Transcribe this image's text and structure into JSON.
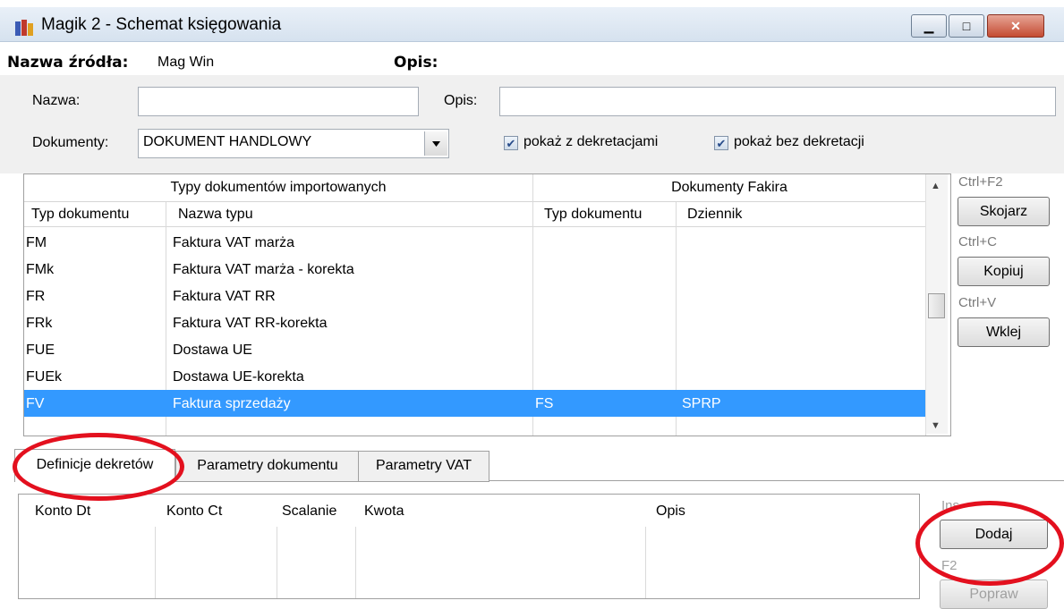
{
  "window": {
    "title": "Magik 2 - Schemat księgowania",
    "controls": {
      "minimize": "▁",
      "maximize": "□",
      "close": "✕"
    }
  },
  "source": {
    "label": "Nazwa źródła:",
    "value": "Mag Win",
    "opis_label": "Opis:"
  },
  "form": {
    "nazwa_label": "Nazwa:",
    "nazwa_value": "",
    "opis_label": "Opis:",
    "opis_value": "",
    "dokumenty_label": "Dokumenty:",
    "dokumenty_value": "DOKUMENT HANDLOWY",
    "checkbox_z": "pokaż z dekretacjami",
    "checkbox_bez": "pokaż bez dekretacji",
    "check_glyph": "✔"
  },
  "grid": {
    "group_imported": "Typy dokumentów importowanych",
    "group_fakir": "Dokumenty Fakira",
    "columns": [
      "Typ dokumentu",
      "Nazwa typu",
      "Typ dokumentu",
      "Dziennik"
    ],
    "rows": [
      {
        "typ": "FM",
        "nazwa": "Faktura VAT marża",
        "typ_fakir": "",
        "dziennik": ""
      },
      {
        "typ": "FMk",
        "nazwa": "Faktura VAT marża - korekta",
        "typ_fakir": "",
        "dziennik": ""
      },
      {
        "typ": "FR",
        "nazwa": "Faktura VAT RR",
        "typ_fakir": "",
        "dziennik": ""
      },
      {
        "typ": "FRk",
        "nazwa": "Faktura VAT RR-korekta",
        "typ_fakir": "",
        "dziennik": ""
      },
      {
        "typ": "FUE",
        "nazwa": "Dostawa UE",
        "typ_fakir": "",
        "dziennik": ""
      },
      {
        "typ": "FUEk",
        "nazwa": "Dostawa UE-korekta",
        "typ_fakir": "",
        "dziennik": ""
      },
      {
        "typ": "FV",
        "nazwa": "Faktura sprzedaży",
        "typ_fakir": "FS",
        "dziennik": "SPRP"
      }
    ],
    "selected_row": 6
  },
  "side_buttons": {
    "skojarz_shortcut": "Ctrl+F2",
    "skojarz": "Skojarz",
    "kopiuj_shortcut": "Ctrl+C",
    "kopiuj": "Kopiuj",
    "wklej_shortcut": "Ctrl+V",
    "wklej": "Wklej"
  },
  "tabs": [
    "Definicje dekretów",
    "Parametry dokumentu",
    "Parametry VAT"
  ],
  "active_tab": 0,
  "dekrety": {
    "columns": [
      "Konto Dt",
      "Konto Ct",
      "Scalanie",
      "Kwota",
      "Opis"
    ],
    "ins_shortcut": "Ins",
    "dodaj": "Dodaj",
    "f2_shortcut": "F2",
    "popraw": "Popraw"
  },
  "colors": {
    "selection": "#3399ff",
    "annotation": "#e3101e"
  }
}
